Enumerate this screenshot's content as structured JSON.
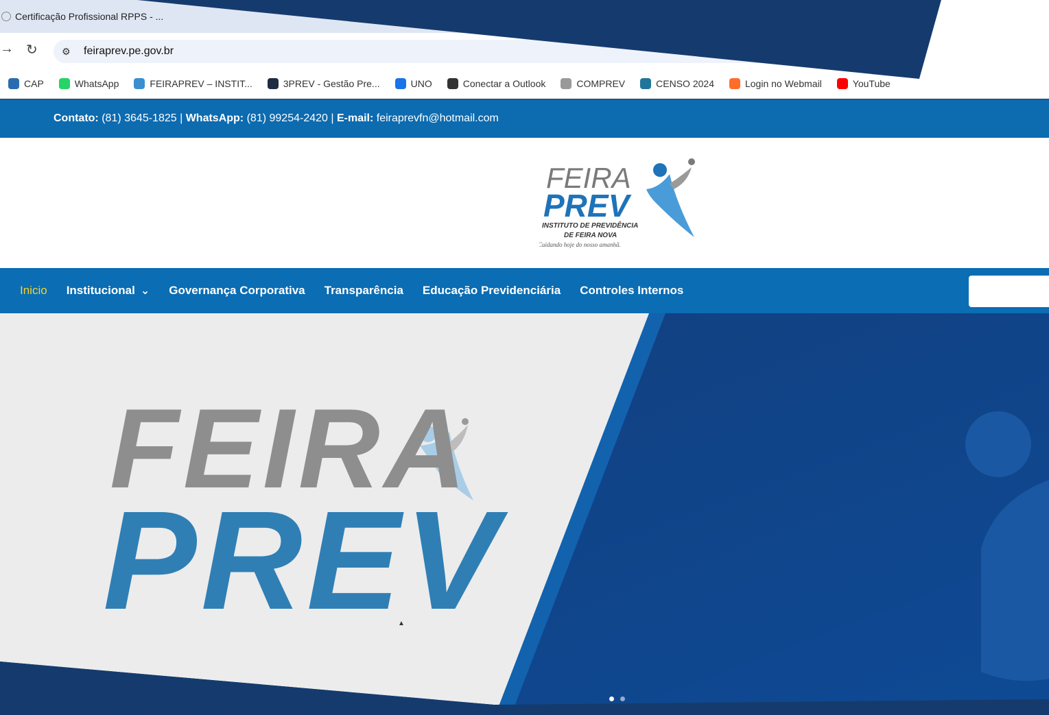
{
  "browser": {
    "tab_title": "Certificação Profissional RPPS - ...",
    "url": "feiraprev.pe.gov.br",
    "bookmarks": [
      {
        "label": "CAP",
        "icon": "cap-icon",
        "color": "#2b6cb0"
      },
      {
        "label": "WhatsApp",
        "icon": "whatsapp-icon",
        "color": "#25d366"
      },
      {
        "label": "FEIRAPREV – INSTIT...",
        "icon": "feiraprev-icon",
        "color": "#3a8fd0"
      },
      {
        "label": "3PREV - Gestão Pre...",
        "icon": "3prev-icon",
        "color": "#1f2a44"
      },
      {
        "label": "UNO",
        "icon": "uno-icon",
        "color": "#1a73e8"
      },
      {
        "label": "Conectar a Outlook",
        "icon": "outlook-icon",
        "color": "#333333"
      },
      {
        "label": "COMPREV",
        "icon": "comprev-icon",
        "color": "#999999"
      },
      {
        "label": "CENSO 2024",
        "icon": "wordpress-icon",
        "color": "#21759b"
      },
      {
        "label": "Login no Webmail",
        "icon": "cpanel-icon",
        "color": "#ff6c2c"
      },
      {
        "label": "YouTube",
        "icon": "youtube-icon",
        "color": "#ff0000"
      }
    ]
  },
  "contact": {
    "phone_label": "Contato:",
    "phone": "(81) 3645-1825",
    "whatsapp_label": "WhatsApp:",
    "whatsapp": "(81) 99254-2420",
    "email_label": "E-mail:",
    "email": "feiraprevfn@hotmail.com",
    "sep": "|"
  },
  "logo": {
    "line1": "FEIRA",
    "line2": "PREV",
    "line3": "INSTITUTO DE PREVIDÊNCIA",
    "line4": "DE FEIRA NOVA",
    "tagline": "Cuidando hoje do nosso amanhã."
  },
  "nav": {
    "items": [
      {
        "label": "Inicio",
        "active": true
      },
      {
        "label": "Institucional",
        "dropdown": true
      },
      {
        "label": "Governança Corporativa"
      },
      {
        "label": "Transparência"
      },
      {
        "label": "Educação Previdenciária"
      },
      {
        "label": "Controles Internos"
      }
    ]
  },
  "hero": {
    "word1": "FEIRA",
    "word2": "PREV",
    "slides": 2,
    "active_slide": 0
  },
  "colors": {
    "contact_bar": "#0d6bb0",
    "nav_bar": "#0b6db3",
    "active_nav": "#f5d22b",
    "hero_dark": "#103f7d",
    "hero_light": "#ececec",
    "frame": "#153b6e"
  }
}
